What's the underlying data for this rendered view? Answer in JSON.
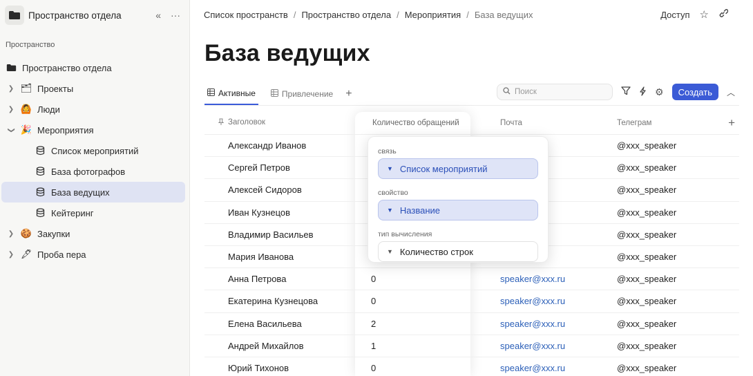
{
  "sidebar": {
    "workspace_title": "Пространство отдела",
    "section_label": "Пространство",
    "items": [
      {
        "label": "Пространство отдела"
      },
      {
        "label": "Проекты",
        "emoji": "🗂"
      },
      {
        "label": "Люди",
        "emoji": "🙆"
      },
      {
        "label": "Мероприятия",
        "emoji": "🎉"
      },
      {
        "label": "Список мероприятий"
      },
      {
        "label": "База фотографов"
      },
      {
        "label": "База ведущих"
      },
      {
        "label": "Кейтеринг"
      },
      {
        "label": "Закупки",
        "emoji": "🍪"
      },
      {
        "label": "Проба пера",
        "emoji": "🖋"
      }
    ]
  },
  "breadcrumbs": [
    "Список пространств",
    "Пространство отдела",
    "Мероприятия",
    "База ведущих"
  ],
  "header": {
    "access_label": "Доступ"
  },
  "page_title": "База ведущих",
  "tabs": [
    {
      "label": "Активные"
    },
    {
      "label": "Привлечение"
    }
  ],
  "search": {
    "placeholder": "Поиск"
  },
  "create_button": "Создать",
  "table": {
    "columns": [
      "Заголовок",
      "Количество обращений",
      "Почта",
      "Телеграм"
    ],
    "rows": [
      {
        "title": "Александр Иванов",
        "count": "",
        "email": "",
        "telegram": "@xxx_speaker"
      },
      {
        "title": "Сергей Петров",
        "count": "",
        "email": "",
        "telegram": "@xxx_speaker"
      },
      {
        "title": "Алексей Сидоров",
        "count": "",
        "email": "",
        "telegram": "@xxx_speaker"
      },
      {
        "title": "Иван Кузнецов",
        "count": "",
        "email": "",
        "telegram": "@xxx_speaker"
      },
      {
        "title": "Владимир Васильев",
        "count": "",
        "email": "",
        "telegram": "@xxx_speaker"
      },
      {
        "title": "Мария Иванова",
        "count": "",
        "email": "",
        "telegram": "@xxx_speaker"
      },
      {
        "title": "Анна Петрова",
        "count": "0",
        "email": "speaker@xxx.ru",
        "telegram": "@xxx_speaker"
      },
      {
        "title": "Екатерина Кузнецова",
        "count": "0",
        "email": "speaker@xxx.ru",
        "telegram": "@xxx_speaker"
      },
      {
        "title": "Елена Васильева",
        "count": "2",
        "email": "speaker@xxx.ru",
        "telegram": "@xxx_speaker"
      },
      {
        "title": "Андрей Михайлов",
        "count": "1",
        "email": "speaker@xxx.ru",
        "telegram": "@xxx_speaker"
      },
      {
        "title": "Юрий Тихонов",
        "count": "0",
        "email": "speaker@xxx.ru",
        "telegram": "@xxx_speaker"
      }
    ]
  },
  "popup": {
    "relation_label": "связь",
    "relation_value": "Список мероприятий",
    "property_label": "свойство",
    "property_value": "Название",
    "calc_label": "тип вычисления",
    "calc_value": "Количество строк"
  },
  "colors": {
    "accent": "#3b5bd6",
    "link": "#2b5fb8",
    "active_nav": "#dfe3f3"
  }
}
